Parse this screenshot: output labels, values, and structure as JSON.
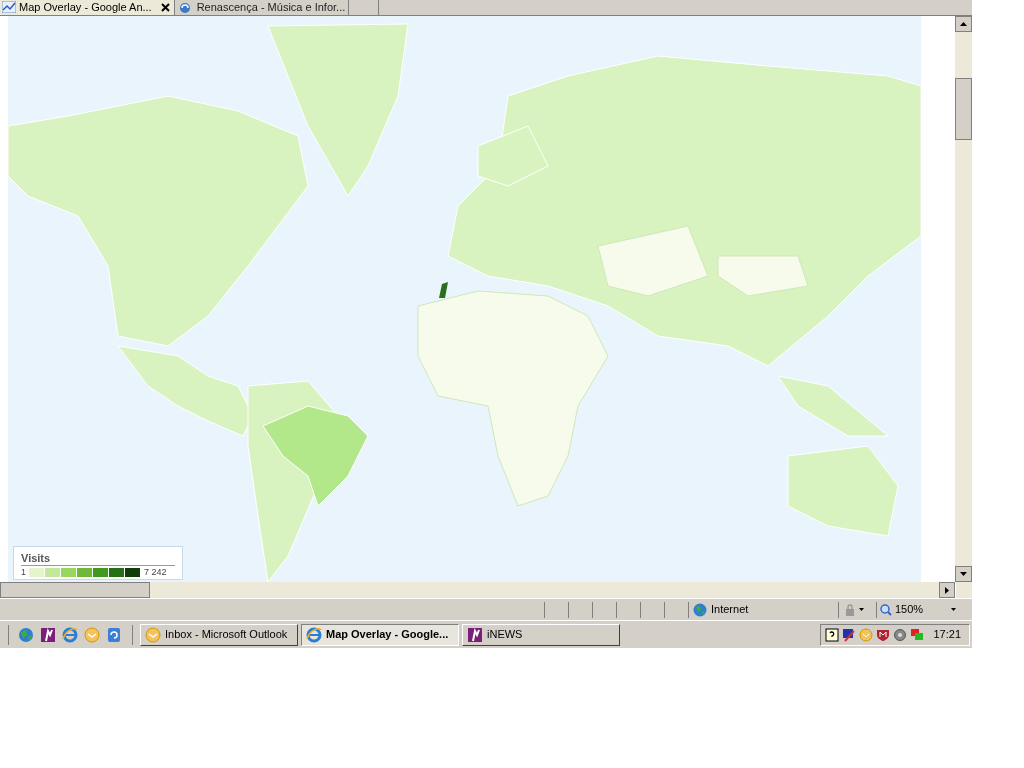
{
  "tabs": [
    {
      "label": "Map Overlay - Google An...",
      "selected": true,
      "closable": true
    },
    {
      "label": "Renascença - Música e Infor...",
      "selected": false,
      "closable": false
    }
  ],
  "legend": {
    "title": "Visits",
    "min": "1",
    "max": "7 242",
    "steps": [
      {
        "color": "#e6f5c9"
      },
      {
        "color": "#c2e89a"
      },
      {
        "color": "#98d65e"
      },
      {
        "color": "#6cba37"
      },
      {
        "color": "#3f9a1f"
      },
      {
        "color": "#236f12"
      },
      {
        "color": "#0f3d08"
      }
    ]
  },
  "status_bar": {
    "zone": "Internet",
    "zoom": "150%"
  },
  "taskbar": {
    "quick_launch": [
      {
        "kind": "globe"
      },
      {
        "kind": "inews"
      },
      {
        "kind": "ie"
      },
      {
        "kind": "outlook"
      },
      {
        "kind": "refresh"
      }
    ],
    "windows": [
      {
        "label": "Inbox - Microsoft Outlook",
        "kind": "outlook",
        "selected": false
      },
      {
        "label": "Map Overlay - Google...",
        "kind": "ie",
        "selected": true
      },
      {
        "label": "iNEWS",
        "kind": "inews",
        "selected": false
      }
    ],
    "clock": "17:21"
  }
}
